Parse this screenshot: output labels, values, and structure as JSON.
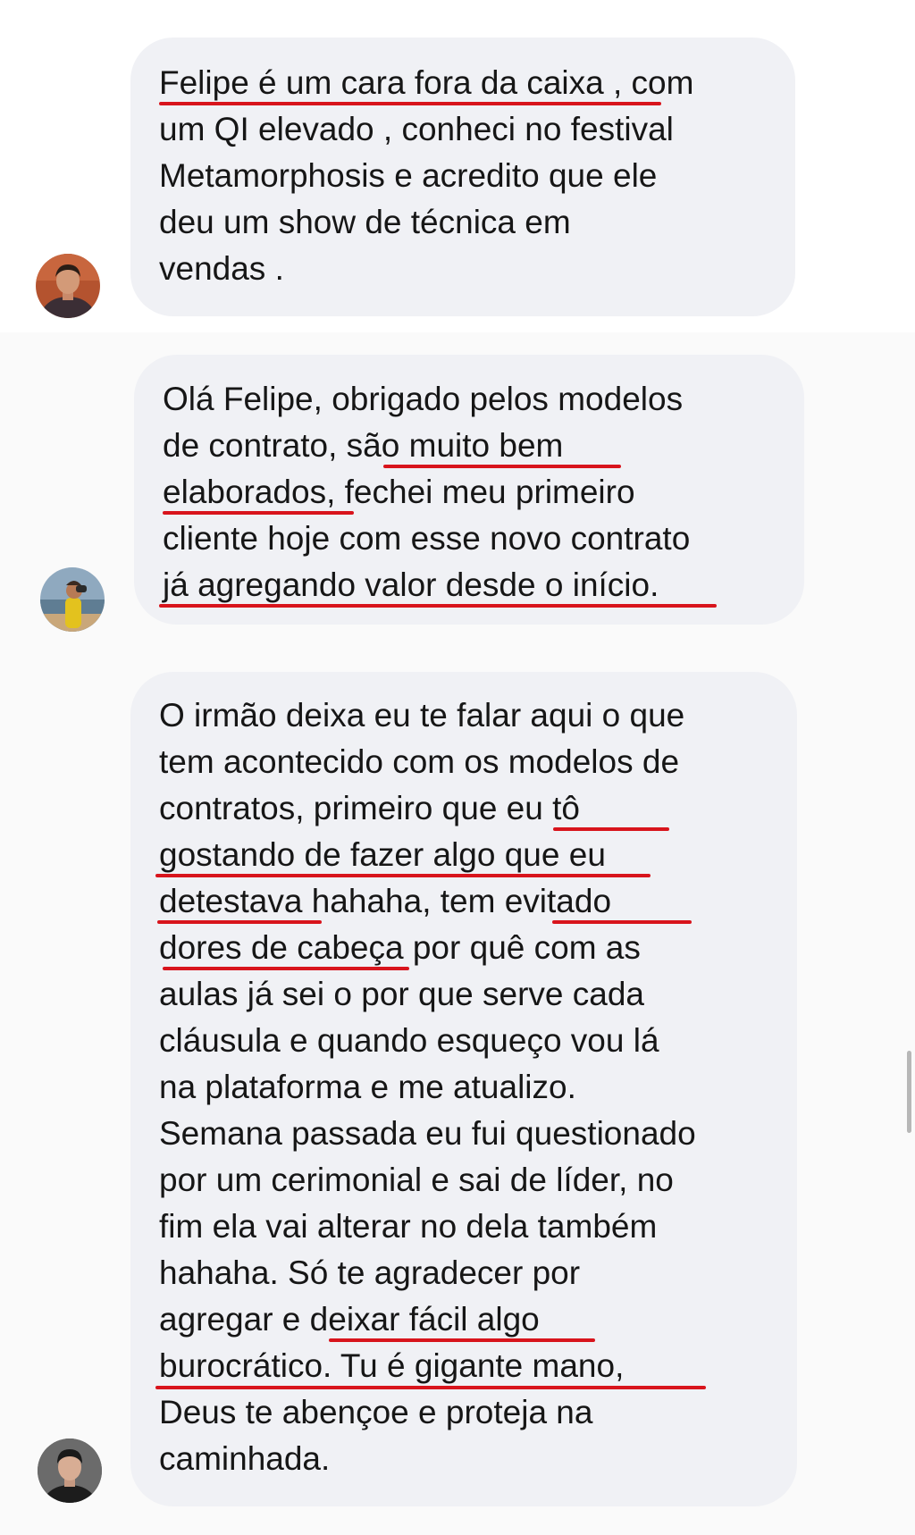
{
  "theme": {
    "bubble_bg": "#f0f1f5",
    "underline_color": "#d8141c",
    "text_color": "#161616"
  },
  "messages": [
    {
      "avatar_icon": "person-portrait-icon",
      "lines": [
        "Felipe é um cara fora da caixa , com",
        "um QI elevado , conheci no festival",
        "Metamorphosis e acredito que ele",
        "deu um show de técnica em",
        "vendas ."
      ]
    },
    {
      "avatar_icon": "person-beach-binoculars-icon",
      "lines": [
        "Olá Felipe, obrigado pelos modelos",
        "de contrato, são muito bem",
        "elaborados, fechei meu primeiro",
        "cliente hoje com esse novo contrato",
        "já agregando valor desde o início."
      ]
    },
    {
      "avatar_icon": "person-portrait-icon",
      "lines": [
        "O irmão deixa eu te falar aqui o que",
        "tem acontecido com os modelos de",
        "contratos, primeiro que eu tô",
        "gostando de fazer algo que eu",
        "detestava hahaha, tem evitado",
        "dores de cabeça por quê com as",
        "aulas já sei o por que serve cada",
        "cláusula e quando esqueço vou lá",
        "na plataforma e me atualizo.",
        "Semana passada eu fui questionado",
        "por um cerimonial e sai de líder, no",
        "fim ela vai alterar no dela também",
        "hahaha. Só te agradecer por",
        "agregar e deixar fácil algo",
        "burocrático. Tu é gigante mano,",
        "Deus te abençoe e proteja na",
        "caminhada."
      ]
    }
  ]
}
